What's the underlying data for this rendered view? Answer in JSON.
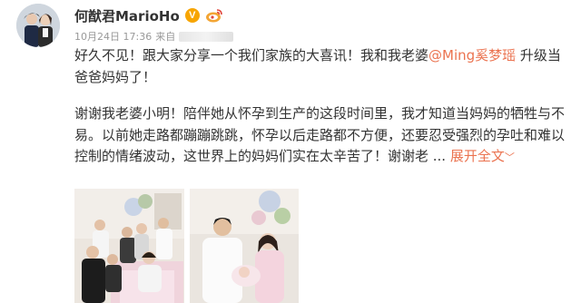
{
  "user": {
    "name": "何猷君MarioHo",
    "verified_badge": "V"
  },
  "meta": {
    "timestamp": "10月24日 17:36",
    "source_prefix": "来自"
  },
  "post": {
    "para1_before": "好久不见！跟大家分享一个我们家族的大喜讯！我和我老婆",
    "para1_mention": "@Ming奚梦瑶",
    "para1_after": " 升级当爸爸妈妈了！",
    "para2": "谢谢我老婆小明！陪伴她从怀孕到生产的这段时间里，我才知道当妈妈的牺牲与不易。以前她走路都蹦蹦跳跳，怀孕以后走路都不方便，还要忍受强烈的孕吐和难以控制的情绪波动，这世界上的妈妈们实在太辛苦了！谢谢老 ... ",
    "expand_label": "展开全文",
    "expand_chevron": "﹀"
  },
  "icons": {
    "avatar": "avatar-image",
    "verified": "verified-v-icon",
    "level": "weibo-level-icon",
    "photo1": "family-hospital-photo",
    "photo2": "couple-baby-photo"
  },
  "colors": {
    "link": "#eb7350",
    "text": "#333333",
    "meta": "#999999",
    "badge": "#f7a500"
  }
}
